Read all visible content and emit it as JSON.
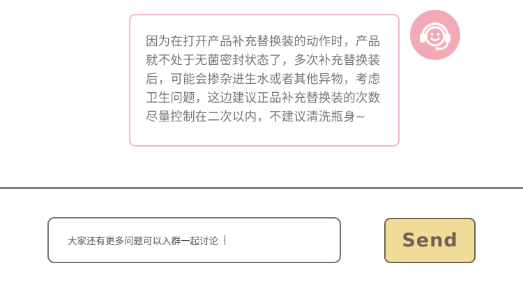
{
  "chat": {
    "message_lines": [
      "因为在打开产品补充替换装的动作时，产品",
      "就不处于无菌密封状态了，多次补充替换装",
      "后，可能会掺杂进生水或者其他异物，考虑",
      "卫生问题，这边建议正品补充替换装的次数",
      "尽量控制在二次以内，不建议清洗瓶身~"
    ],
    "avatar_icon": "support-agent-headset-icon",
    "avatar_color": "#f4a9b6",
    "bubble_border_color": "#f2b8c6"
  },
  "composer": {
    "input_value": "大家还有更多问题可以入群一起讨论",
    "send_label": "Send",
    "send_color": "#f0dc97"
  }
}
